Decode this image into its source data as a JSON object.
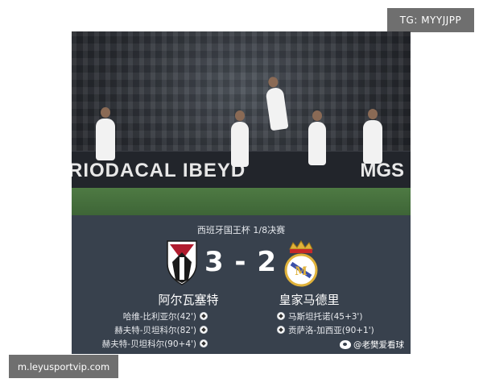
{
  "watermark_top": "TG: MYYJJPP",
  "watermark_bottom": "m.leyusportvip.com",
  "photo": {
    "ad_left": "RIODACAL IBEYD",
    "ad_right": "MGS"
  },
  "match": {
    "competition": "西班牙国王杯 1/8决赛",
    "score": "3 - 2",
    "home": {
      "name": "阿尔瓦塞特",
      "crest": "albacete-crest",
      "scorers": [
        "哈维-比利亚尔(42')",
        "赫夫特-贝坦科尔(82')",
        "赫夫特-贝坦科尔(90+4')"
      ]
    },
    "away": {
      "name": "皇家马德里",
      "crest": "real-madrid-crest",
      "scorers": [
        "马斯坦托诺(45+3')",
        "贡萨洛-加西亚(90+1')"
      ]
    }
  },
  "credit": "@老樊爱看球",
  "colors": {
    "card_bg": "#38414d",
    "badge_bg": "#6f6f6f",
    "pitch": "#4e7a43"
  }
}
